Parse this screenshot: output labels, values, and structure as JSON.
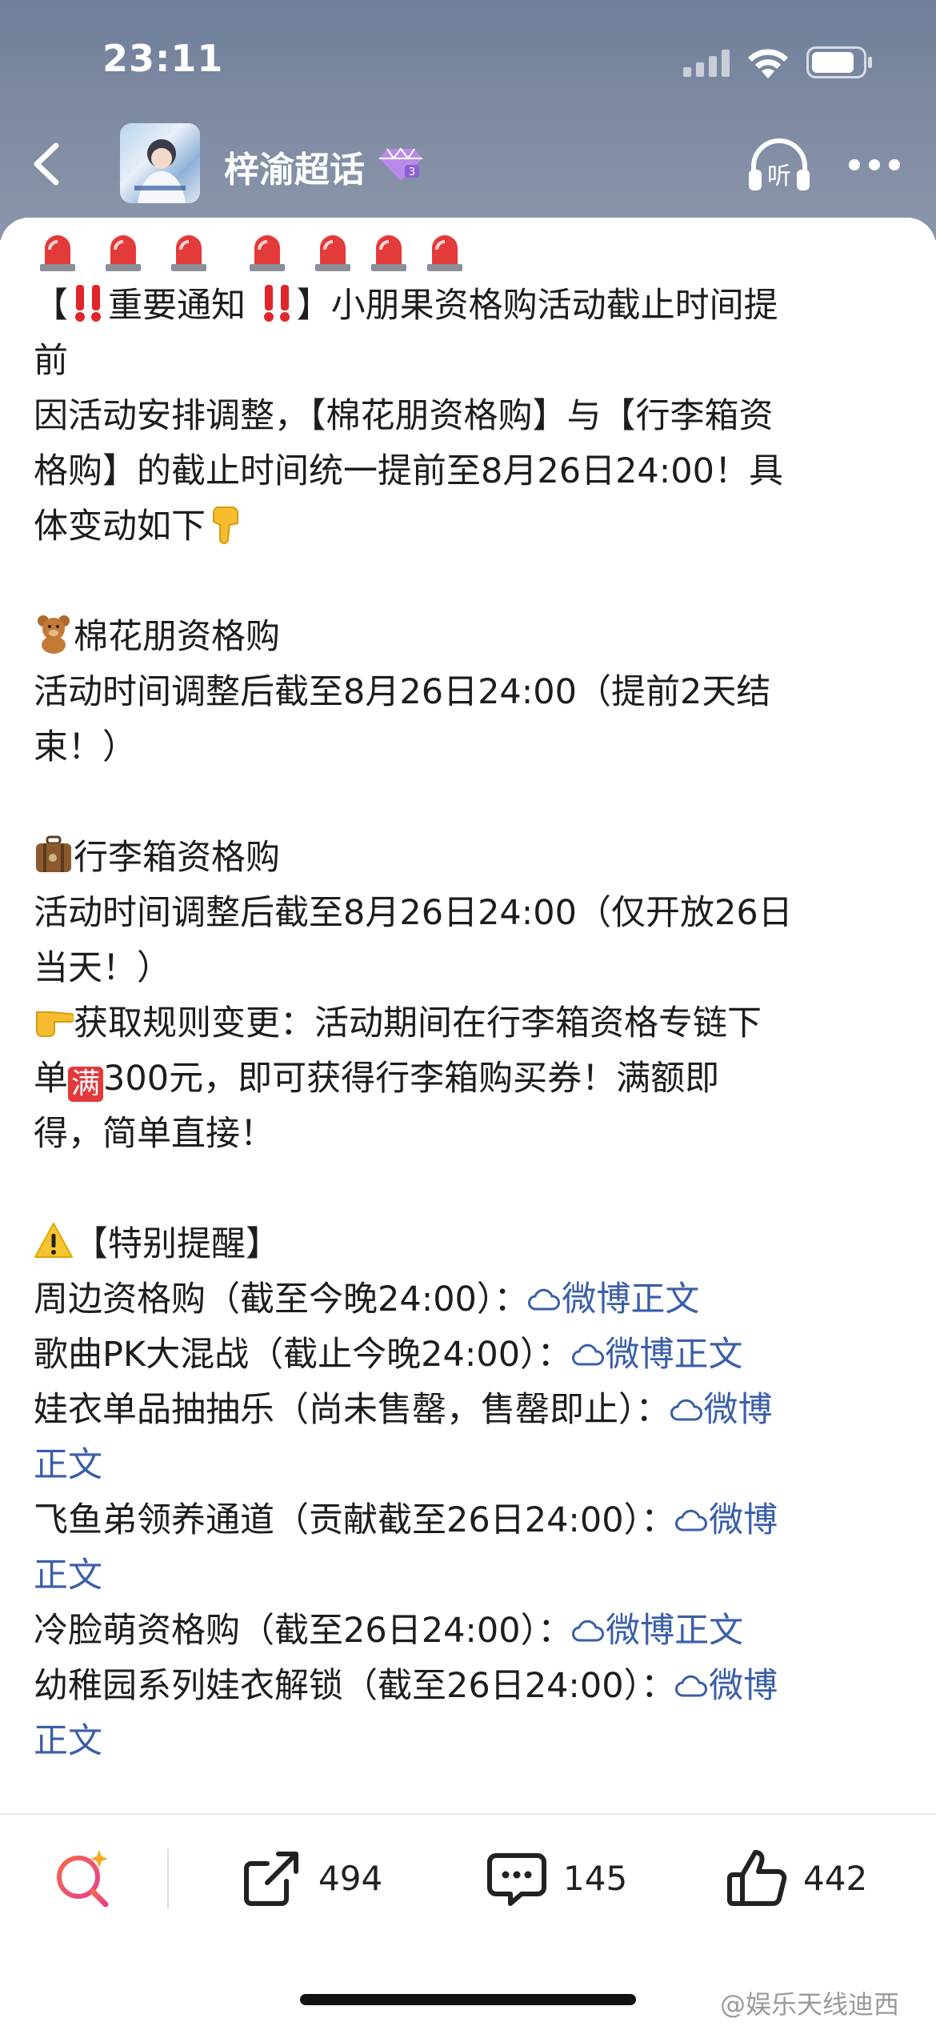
{
  "status_bar": {
    "time": "23:11"
  },
  "header": {
    "title": "梓渝超话"
  },
  "post": {
    "lines": [
      {
        "parts": [
          {
            "t": "【"
          },
          {
            "emoji": "double-exclamation"
          },
          {
            "t": "重要通知 "
          },
          {
            "emoji": "double-exclamation"
          },
          {
            "t": "】小朋果资格购活动截止时间提"
          }
        ]
      },
      {
        "parts": [
          {
            "t": "前"
          }
        ]
      },
      {
        "parts": [
          {
            "t": "因活动安排调整，【棉花朋资格购】与【行李箱资"
          }
        ]
      },
      {
        "parts": [
          {
            "t": "格购】的截止时间统一提前至8月26日24:00！具"
          }
        ]
      },
      {
        "parts": [
          {
            "t": "体变动如下"
          },
          {
            "emoji": "point-down"
          }
        ]
      },
      {
        "parts": []
      },
      {
        "parts": [
          {
            "emoji": "teddy-bear"
          },
          {
            "t": "棉花朋资格购"
          }
        ]
      },
      {
        "parts": [
          {
            "t": "活动时间调整后截至8月26日24:00（提前2天结"
          }
        ]
      },
      {
        "parts": [
          {
            "t": "束！）"
          }
        ]
      },
      {
        "parts": []
      },
      {
        "parts": [
          {
            "emoji": "suitcase"
          },
          {
            "t": "行李箱资格购"
          }
        ]
      },
      {
        "parts": [
          {
            "t": "活动时间调整后截至8月26日24:00（仅开放26日"
          }
        ]
      },
      {
        "parts": [
          {
            "t": "当天！）"
          }
        ]
      },
      {
        "parts": [
          {
            "emoji": "point-right"
          },
          {
            "t": "获取规则变更：活动期间在行李箱资格专链下"
          }
        ]
      },
      {
        "parts": [
          {
            "t": "单"
          },
          {
            "badge": "满"
          },
          {
            "t": "300元，即可获得行李箱购买券！满额即"
          }
        ]
      },
      {
        "parts": [
          {
            "t": "得，简单直接！"
          }
        ]
      },
      {
        "parts": []
      },
      {
        "parts": [
          {
            "emoji": "warning"
          },
          {
            "t": "【特别提醒】"
          }
        ]
      },
      {
        "parts": [
          {
            "t": "周边资格购（截至今晚24:00）："
          },
          {
            "link": "微博正文"
          }
        ]
      },
      {
        "parts": [
          {
            "t": "歌曲PK大混战（截止今晚24:00）："
          },
          {
            "link": "微博正文"
          }
        ]
      },
      {
        "parts": [
          {
            "t": "娃衣单品抽抽乐（尚未售罄，售罄即止）："
          },
          {
            "link": "微博"
          }
        ]
      },
      {
        "parts": [
          {
            "linktext": "正文"
          }
        ]
      },
      {
        "parts": [
          {
            "t": "飞鱼弟领养通道（贡献截至26日24:00）："
          },
          {
            "link": "微博"
          }
        ]
      },
      {
        "parts": [
          {
            "linktext": "正文"
          }
        ]
      },
      {
        "parts": [
          {
            "t": "冷脸萌资格购（截至26日24:00）："
          },
          {
            "link": "微博正文"
          }
        ]
      },
      {
        "parts": [
          {
            "t": "幼稚园系列娃衣解锁（截至26日24:00）："
          },
          {
            "link": "微博"
          }
        ]
      },
      {
        "parts": [
          {
            "linktext": "正文"
          }
        ]
      }
    ]
  },
  "actions": {
    "share_count": "494",
    "comment_count": "145",
    "like_count": "442"
  },
  "watermark": "@娱乐天线迪西",
  "colors": {
    "link": "#3a5ea8",
    "header_bg": "#7d8aa2",
    "badge_red": "#e2393b"
  }
}
